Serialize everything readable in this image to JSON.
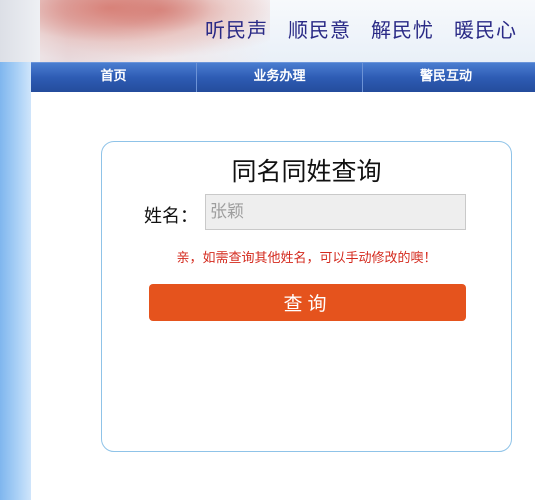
{
  "banner": {
    "slogans": [
      "听民声",
      "顺民意",
      "解民忧",
      "暖民心"
    ]
  },
  "nav": {
    "items": [
      {
        "label": "首页"
      },
      {
        "label": "业务办理"
      },
      {
        "label": "警民互动"
      }
    ]
  },
  "query": {
    "title": "同名同姓查询",
    "name_label": "姓名：",
    "name_value": "",
    "name_placeholder": "张颖",
    "hint": "亲，如需查询其他姓名，可以手动修改的噢！",
    "button_label": "查询"
  },
  "colors": {
    "nav_blue": "#2e5cb4",
    "button_orange": "#e5531d",
    "hint_red": "#d42a1e",
    "slogan_navy": "#2a2a86"
  }
}
